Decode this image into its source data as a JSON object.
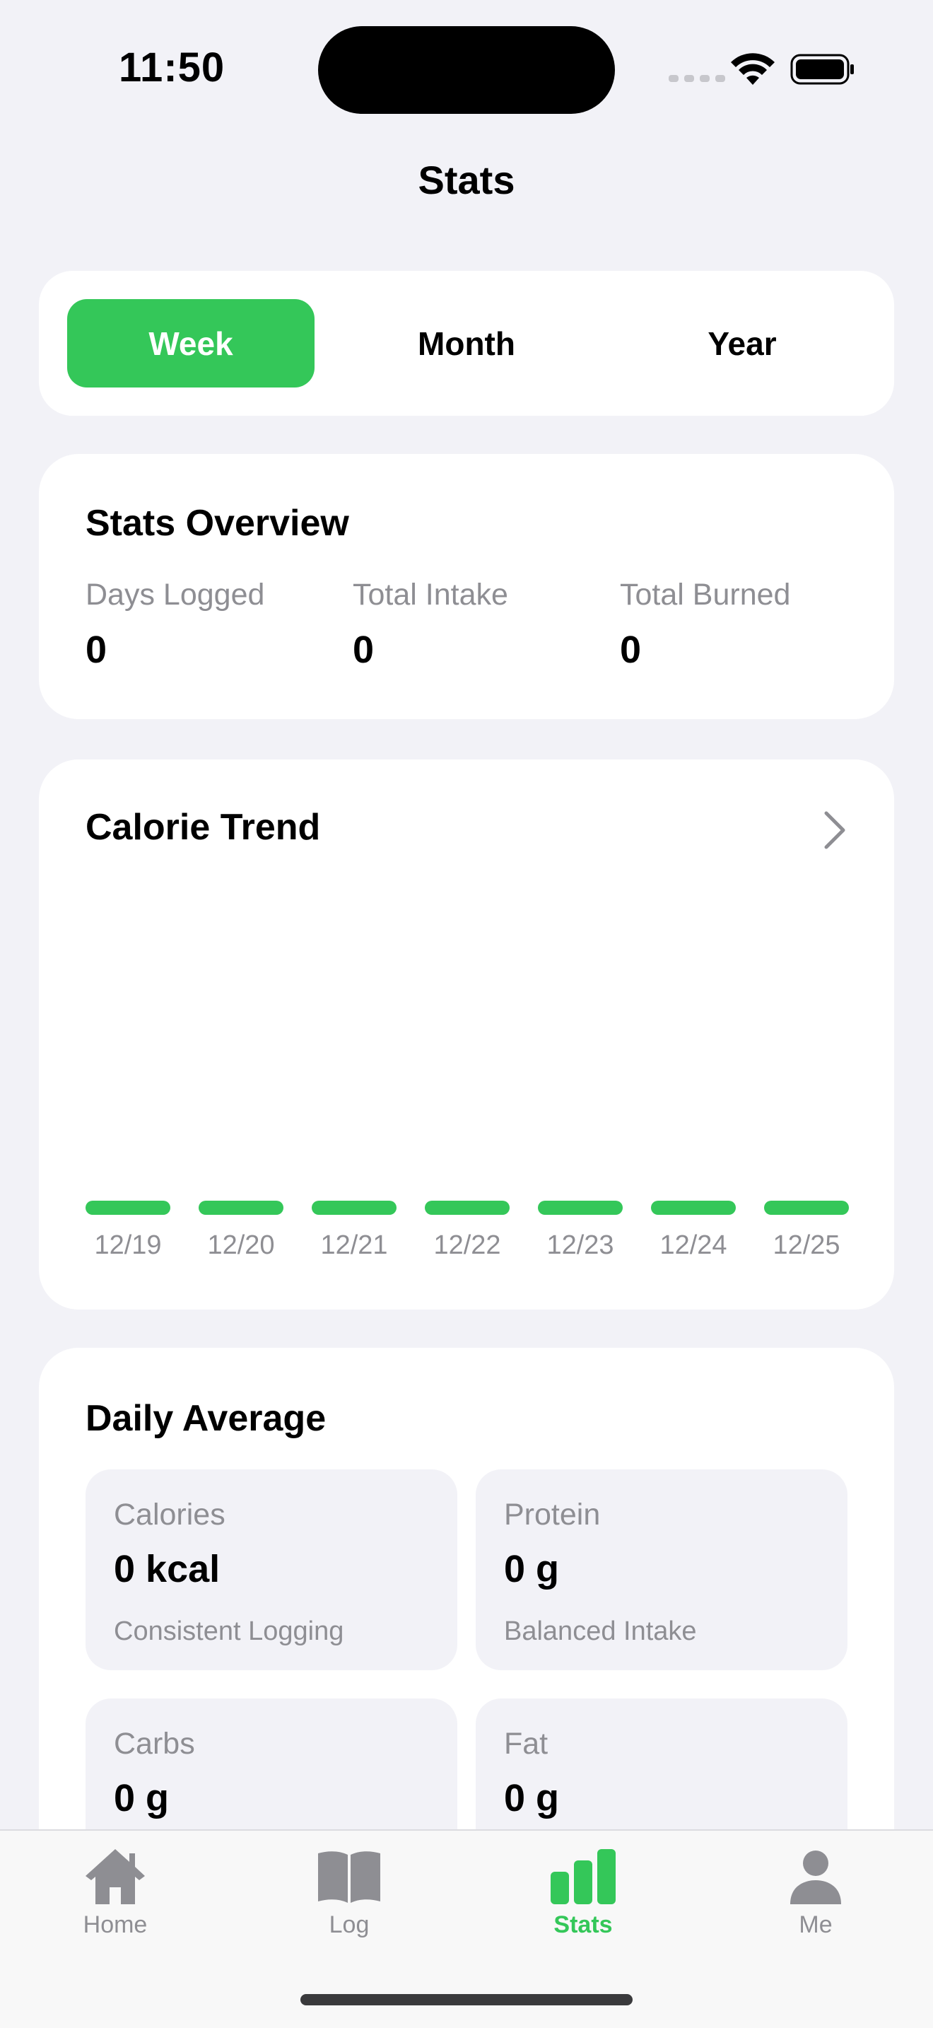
{
  "status_bar": {
    "time": "11:50"
  },
  "header": {
    "title": "Stats"
  },
  "period_tabs": [
    {
      "label": "Week",
      "active": true
    },
    {
      "label": "Month",
      "active": false
    },
    {
      "label": "Year",
      "active": false
    }
  ],
  "overview": {
    "title": "Stats Overview",
    "metrics": [
      {
        "label": "Days Logged",
        "value": "0"
      },
      {
        "label": "Total Intake",
        "value": "0"
      },
      {
        "label": "Total Burned",
        "value": "0"
      }
    ]
  },
  "calorie_trend": {
    "title": "Calorie Trend",
    "chevron_icon": "chevron-right-icon",
    "accent_color": "#34c759",
    "dates": [
      "12/19",
      "12/20",
      "12/21",
      "12/22",
      "12/23",
      "12/24",
      "12/25"
    ],
    "values": [
      0,
      0,
      0,
      0,
      0,
      0,
      0
    ]
  },
  "daily_average": {
    "title": "Daily Average",
    "tiles": [
      {
        "label": "Calories",
        "value": "0 kcal",
        "sub": "Consistent Logging"
      },
      {
        "label": "Protein",
        "value": "0 g",
        "sub": "Balanced Intake"
      },
      {
        "label": "Carbs",
        "value": "0 g",
        "sub": ""
      },
      {
        "label": "Fat",
        "value": "0 g",
        "sub": ""
      }
    ]
  },
  "tab_bar": {
    "items": [
      {
        "label": "Home",
        "icon": "house-icon",
        "active": false
      },
      {
        "label": "Log",
        "icon": "book-icon",
        "active": false
      },
      {
        "label": "Stats",
        "icon": "bar-chart-icon",
        "active": true
      },
      {
        "label": "Me",
        "icon": "person-icon",
        "active": false
      }
    ],
    "active_color": "#34c759",
    "inactive_color": "#8e8e93"
  }
}
